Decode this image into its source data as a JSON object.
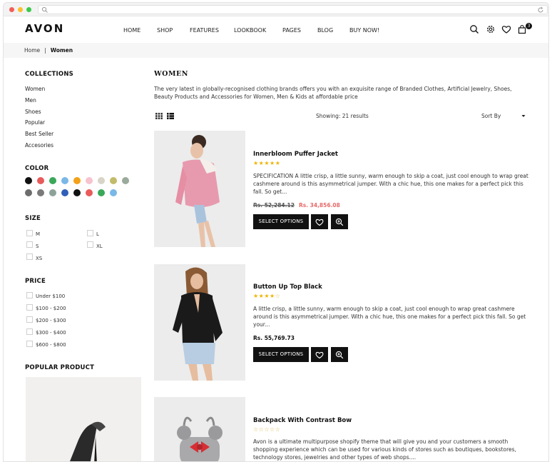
{
  "header": {
    "logo": "AVON",
    "nav": [
      "HOME",
      "SHOP",
      "FEATURES",
      "LOOKBOOK",
      "PAGES",
      "BLOG",
      "BUY NOW!"
    ],
    "cart_count": "3"
  },
  "breadcrumb": {
    "home": "Home",
    "separator": "|",
    "current": "Women"
  },
  "sidebar": {
    "collections_title": "COLLECTIONS",
    "collections": [
      "Women",
      "Men",
      "Shoes",
      "Popular",
      "Best Seller",
      "Accesories"
    ],
    "color_title": "COLOR",
    "colors_row1": [
      "#111111",
      "#e95b5b",
      "#3aa859",
      "#7ab8e6",
      "#f2a21a",
      "#f6c3cf",
      "#d8d4c8",
      "#c2bb6a",
      "#9aaa9c"
    ],
    "colors_row2": [
      "#6d6d6d",
      "#7a7a7a",
      "#8da39a",
      "#2f5fb8",
      "#111111",
      "#e95b5b",
      "#3aa859",
      "#7ab8e6"
    ],
    "size_title": "SIZE",
    "sizes": [
      "M",
      "L",
      "S",
      "XL",
      "XS"
    ],
    "price_title": "PRICE",
    "prices": [
      "Under $100",
      "$100 - $200",
      "$200 - $300",
      "$300 - $400",
      "$600 - $800"
    ],
    "popular_title": "POPULAR PRODUCT"
  },
  "main": {
    "title": "WOMEN",
    "description": "The very latest in globally-recognised clothing brands offers you with an exquisite range of Branded Clothes, Artificial Jewelry, Shoes, Beauty Products and Accessories for Women, Men & Kids at affordable price",
    "showing": "Showing: 21 results",
    "sort_by": "Sort By"
  },
  "products": [
    {
      "name": "Innerbloom Puffer Jacket",
      "rating": 5,
      "stars": "★★★★★",
      "description": "SPECIFICATION A little crisp, a little sunny, warm enough to skip a coat, just cool enough to wrap great cashmere around is this asymmetrical jumper. With a chic hue, this one makes for a perfect pick this fall. So get...",
      "price_old": "Rs. 52,284.12",
      "price_new": "Rs. 34,856.08",
      "button": "SELECT OPTIONS"
    },
    {
      "name": "Button Up Top Black",
      "rating": 4,
      "stars_on": "★★★★",
      "stars_off": "☆",
      "description": "A little crisp, a little sunny, warm enough to skip a coat, just cool enough to wrap great cashmere around is this asymmetrical jumper. With a chic hue, this one makes for a perfect pick this fall. So get your...",
      "price": "Rs. 55,769.73",
      "button": "SELECT OPTIONS"
    },
    {
      "name": "Backpack With Contrast Bow",
      "rating": 0,
      "stars_off": "☆☆☆☆☆",
      "description": "Avon is a ultimate multipurpose shopify theme that will give you and your customers a smooth shopping experience which can be used for various kinds of stores such as boutiques, bookstores, technology stores, jewelries and other types of web shops...."
    }
  ],
  "icons": [
    "search-icon",
    "gear-icon",
    "heart-icon",
    "cart-icon",
    "grid-view-icon",
    "list-view-icon",
    "zoom-icon"
  ]
}
